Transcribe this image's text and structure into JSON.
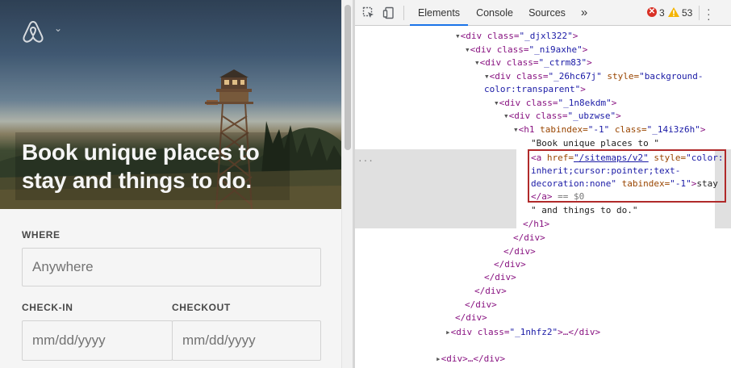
{
  "page": {
    "hero_title": "Book unique places to stay and things to do.",
    "logo_chevron": "⌄",
    "form": {
      "where_label": "WHERE",
      "where_placeholder": "Anywhere",
      "checkin_label": "CHECK-IN",
      "checkin_placeholder": "mm/dd/yyyy",
      "checkout_label": "CHECKOUT",
      "checkout_placeholder": "mm/dd/yyyy"
    }
  },
  "devtools": {
    "tabs": [
      {
        "label": "Elements",
        "active": true
      },
      {
        "label": "Console",
        "active": false
      },
      {
        "label": "Sources",
        "active": false
      }
    ],
    "more_tabs": "»",
    "errors": "3",
    "warnings": "53",
    "error_icon_glyph": "✕",
    "collapsed_dots": "...",
    "lines": {
      "l0": "\"",
      "l1": {
        "tag": "<div class=",
        "val": "\"_djxl322\"",
        "end": ">"
      },
      "l2": {
        "tag": "<div class=",
        "val": "\"_ni9axhe\"",
        "end": ">"
      },
      "l3": {
        "tag": "<div class=",
        "val": "\"_ctrm83\"",
        "end": ">"
      },
      "l4": {
        "tag": "<div class=",
        "val": "\"_26hc67j\"",
        "attr": " style=",
        "val2": "\"background-"
      },
      "l4b": {
        "val": "color:transparent\"",
        "end": ">"
      },
      "l5": {
        "tag": "<div class=",
        "val": "\"_1n8ekdm\"",
        "end": ">"
      },
      "l6": {
        "tag": "<div class=",
        "val": "\"_ubzwse\"",
        "end": ">"
      },
      "l7": {
        "tag": "<h1 ",
        "attr": "tabindex=",
        "val": "\"-1\"",
        "attr2": " class=",
        "val2": "\"_14i3z6h\"",
        "end": ">"
      },
      "l8": "\"Book unique places to \"",
      "l9": {
        "tag": "<a ",
        "attr": "href=",
        "link": "\"/sitemaps/v2\"",
        "attr2": " style=",
        "val": "\"color:"
      },
      "l10": "inherit;cursor:pointer;text-",
      "l11": {
        "val": "decoration:none\"",
        "attr": " tabindex=",
        "val2": "\"-1\"",
        "end": ">",
        "text": "stay"
      },
      "l12": {
        "tag": "</a>",
        "text": " == $0"
      },
      "l13": "\" and things to do.\"",
      "l14": "</h1>",
      "close": "</div>",
      "l21": {
        "tag": "<div class=",
        "val": "\"_1nhfz2\"",
        "end": ">…</div>"
      },
      "l22": {
        "tag": "<div>",
        "end": "…</div>"
      }
    }
  }
}
